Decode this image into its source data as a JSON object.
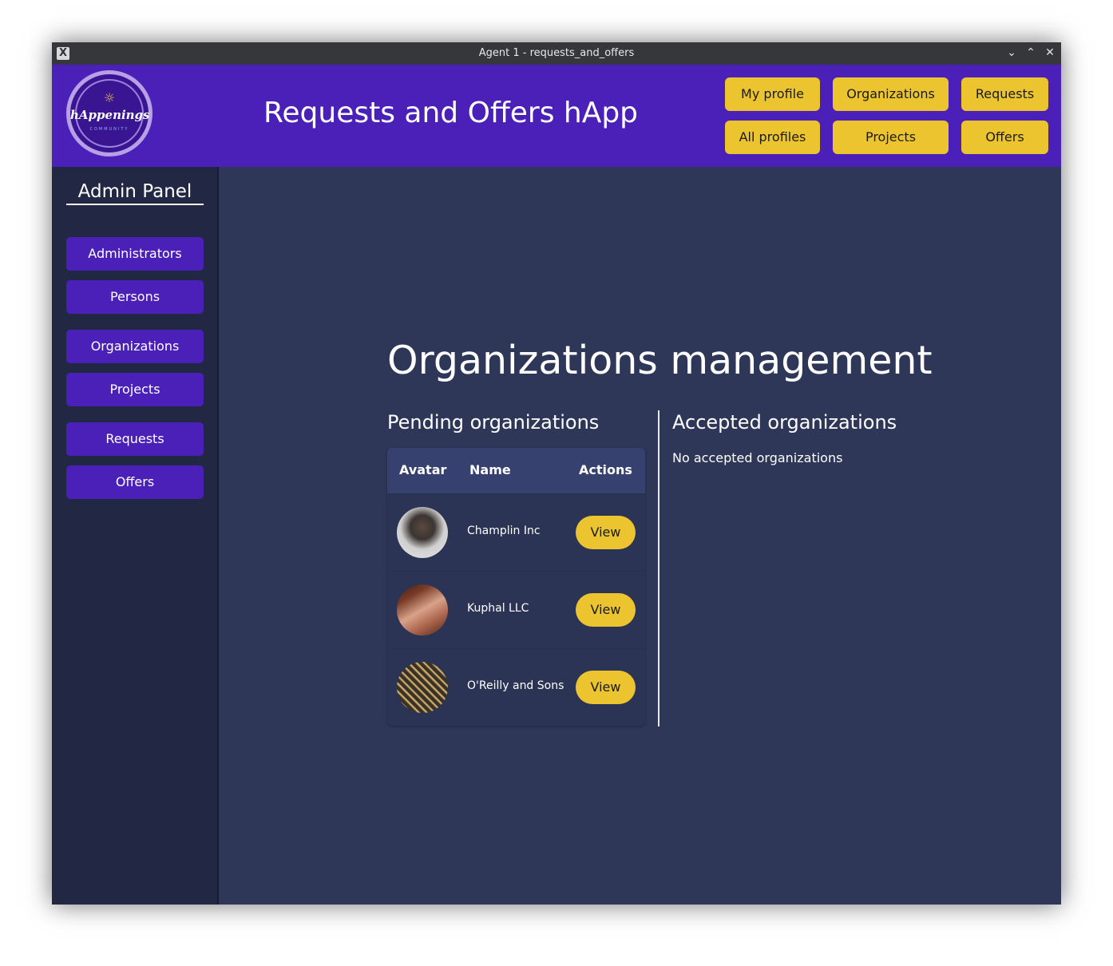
{
  "window": {
    "title": "Agent 1 - requests_and_offers"
  },
  "header": {
    "logo_text": "hAppenings",
    "logo_subtext": "COMMUNITY",
    "title": "Requests and Offers hApp",
    "nav": {
      "my_profile": "My profile",
      "organizations": "Organizations",
      "requests": "Requests",
      "all_profiles": "All profiles",
      "projects": "Projects",
      "offers": "Offers"
    }
  },
  "sidebar": {
    "title": "Admin Panel",
    "items": [
      "Administrators",
      "Persons",
      "Organizations",
      "Projects",
      "Requests",
      "Offers"
    ]
  },
  "main": {
    "heading": "Organizations management",
    "pending": {
      "title": "Pending organizations",
      "columns": [
        "Avatar",
        "Name",
        "Actions"
      ],
      "rows": [
        {
          "name": "Champlin Inc",
          "action": "View"
        },
        {
          "name": "Kuphal LLC",
          "action": "View"
        },
        {
          "name": "O'Reilly and Sons",
          "action": "View"
        }
      ]
    },
    "accepted": {
      "title": "Accepted organizations",
      "empty_text": "No accepted organizations"
    }
  },
  "colors": {
    "header_bg": "#4a20b8",
    "accent_yellow": "#ebc42f",
    "content_bg": "#2e3758",
    "sidebar_bg": "#222843"
  }
}
